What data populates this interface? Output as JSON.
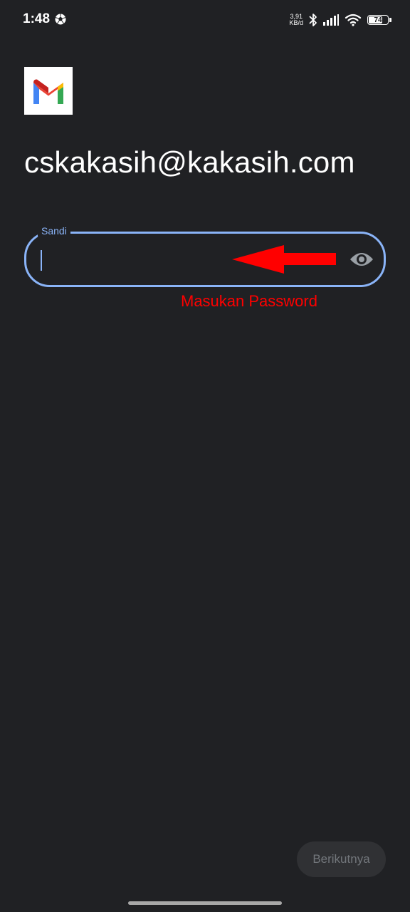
{
  "status_bar": {
    "time": "1:48",
    "net_speed_value": "3,91",
    "net_speed_unit": "KB/d",
    "battery_level": "74",
    "icons": [
      "football-icon",
      "bluetooth-icon",
      "signal-icon",
      "wifi-icon",
      "battery-icon"
    ]
  },
  "account": {
    "logo": "gmail-logo",
    "email": "cskakasih@kakasih.com"
  },
  "password_field": {
    "label": "Sandi",
    "value": "",
    "toggle_icon": "eye-icon"
  },
  "annotation": {
    "arrow_color": "#ff0000",
    "hint": "Masukan Password"
  },
  "footer": {
    "next_label": "Berikutnya"
  },
  "colors": {
    "background": "#202124",
    "accent": "#8ab4f8",
    "annotation": "#ff0000",
    "button_bg": "#303134",
    "button_text": "#72767b"
  }
}
